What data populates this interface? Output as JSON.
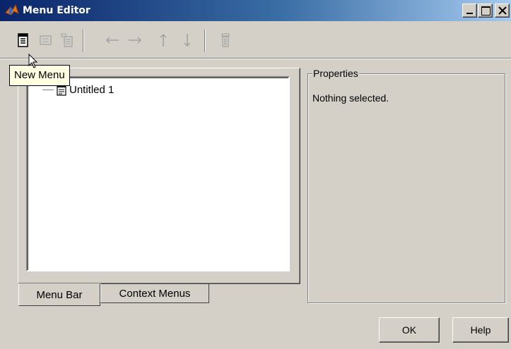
{
  "window": {
    "title": "Menu Editor",
    "icon": "matlab-icon",
    "controls": [
      "minimize-icon",
      "maximize-icon",
      "close-icon"
    ]
  },
  "toolbar": {
    "buttons": [
      {
        "icon": "new-menu-icon",
        "tooltip": "New Menu",
        "enabled": true
      },
      {
        "icon": "new-menu-item-icon",
        "enabled": false
      },
      {
        "icon": "new-context-menu-icon",
        "enabled": false
      },
      {
        "icon": "move-left-arrow-icon",
        "enabled": false
      },
      {
        "icon": "move-right-arrow-icon",
        "enabled": false
      },
      {
        "icon": "move-up-arrow-icon",
        "enabled": false
      },
      {
        "icon": "move-down-arrow-icon",
        "enabled": false
      },
      {
        "icon": "delete-icon",
        "enabled": false
      }
    ]
  },
  "tooltip": {
    "text": "New Menu"
  },
  "tree": {
    "items": [
      {
        "label": "Untitled 1",
        "icon": "menu-item-icon"
      }
    ]
  },
  "tabs": [
    {
      "label": "Menu Bar",
      "active": true
    },
    {
      "label": "Context Menus",
      "active": false
    }
  ],
  "properties": {
    "title": "Properties",
    "status": "Nothing selected."
  },
  "buttons": {
    "ok_label": "OK",
    "help_label": "Help"
  },
  "colors": {
    "titlebar_start": "#0a246a",
    "titlebar_end": "#a6caf0",
    "face": "#d4d0c8",
    "tooltip_bg": "#ffffe1"
  }
}
